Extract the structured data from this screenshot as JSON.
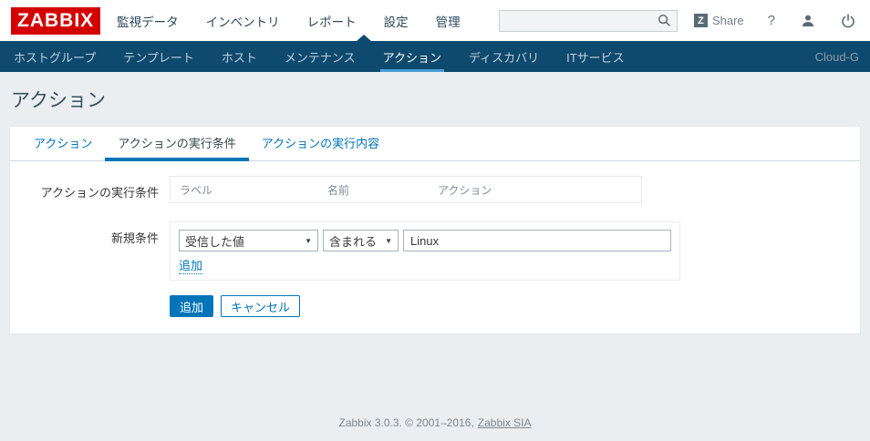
{
  "header": {
    "logo": "ZABBIX",
    "menu": [
      "監視データ",
      "インベントリ",
      "レポート",
      "設定",
      "管理"
    ],
    "active_menu": "設定",
    "search_value": "",
    "share_badge": "Z",
    "share_label": "Share",
    "help_label": "?"
  },
  "subnav": {
    "items": [
      "ホストグループ",
      "テンプレート",
      "ホスト",
      "メンテナンス",
      "アクション",
      "ディスカバリ",
      "ITサービス"
    ],
    "active": "アクション",
    "context": "Cloud-G"
  },
  "page": {
    "title": "アクション"
  },
  "tabs": {
    "items": [
      "アクション",
      "アクションの実行条件",
      "アクションの実行内容"
    ],
    "active": "アクションの実行条件"
  },
  "form": {
    "conditions_label": "アクションの実行条件",
    "columns": [
      "ラベル",
      "名前",
      "アクション"
    ],
    "new_condition_label": "新規条件",
    "condition_type": "受信した値",
    "operator": "含まれる",
    "value": "Linux",
    "select_caret": "▼",
    "add_link": "追加",
    "add_button": "追加",
    "cancel_button": "キャンセル"
  },
  "footer": {
    "text": "Zabbix 3.0.3. © 2001–2016,",
    "link": "Zabbix SIA"
  },
  "colors": {
    "accent": "#0275b8",
    "subnav_bg": "#0e4a6e",
    "logo_red": "#d40000",
    "active_underline": "#4a9fd8",
    "page_bg": "#ebeef0"
  }
}
